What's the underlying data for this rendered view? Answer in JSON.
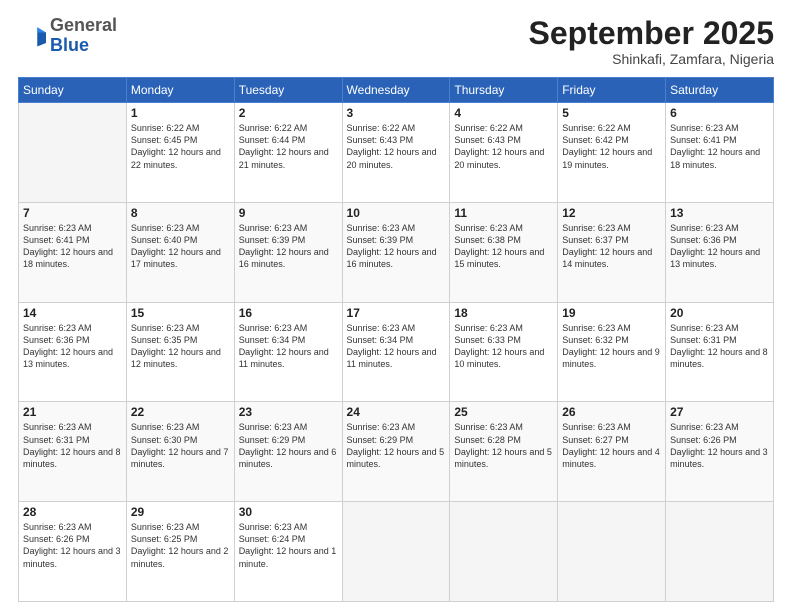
{
  "logo": {
    "general": "General",
    "blue": "Blue"
  },
  "header": {
    "month": "September 2025",
    "location": "Shinkafi, Zamfara, Nigeria"
  },
  "days_of_week": [
    "Sunday",
    "Monday",
    "Tuesday",
    "Wednesday",
    "Thursday",
    "Friday",
    "Saturday"
  ],
  "weeks": [
    [
      {
        "day": "",
        "sunrise": "",
        "sunset": "",
        "daylight": ""
      },
      {
        "day": "1",
        "sunrise": "6:22 AM",
        "sunset": "6:45 PM",
        "daylight": "12 hours and 22 minutes."
      },
      {
        "day": "2",
        "sunrise": "6:22 AM",
        "sunset": "6:44 PM",
        "daylight": "12 hours and 21 minutes."
      },
      {
        "day": "3",
        "sunrise": "6:22 AM",
        "sunset": "6:43 PM",
        "daylight": "12 hours and 20 minutes."
      },
      {
        "day": "4",
        "sunrise": "6:22 AM",
        "sunset": "6:43 PM",
        "daylight": "12 hours and 20 minutes."
      },
      {
        "day": "5",
        "sunrise": "6:22 AM",
        "sunset": "6:42 PM",
        "daylight": "12 hours and 19 minutes."
      },
      {
        "day": "6",
        "sunrise": "6:23 AM",
        "sunset": "6:41 PM",
        "daylight": "12 hours and 18 minutes."
      }
    ],
    [
      {
        "day": "7",
        "sunrise": "6:23 AM",
        "sunset": "6:41 PM",
        "daylight": "12 hours and 18 minutes."
      },
      {
        "day": "8",
        "sunrise": "6:23 AM",
        "sunset": "6:40 PM",
        "daylight": "12 hours and 17 minutes."
      },
      {
        "day": "9",
        "sunrise": "6:23 AM",
        "sunset": "6:39 PM",
        "daylight": "12 hours and 16 minutes."
      },
      {
        "day": "10",
        "sunrise": "6:23 AM",
        "sunset": "6:39 PM",
        "daylight": "12 hours and 16 minutes."
      },
      {
        "day": "11",
        "sunrise": "6:23 AM",
        "sunset": "6:38 PM",
        "daylight": "12 hours and 15 minutes."
      },
      {
        "day": "12",
        "sunrise": "6:23 AM",
        "sunset": "6:37 PM",
        "daylight": "12 hours and 14 minutes."
      },
      {
        "day": "13",
        "sunrise": "6:23 AM",
        "sunset": "6:36 PM",
        "daylight": "12 hours and 13 minutes."
      }
    ],
    [
      {
        "day": "14",
        "sunrise": "6:23 AM",
        "sunset": "6:36 PM",
        "daylight": "12 hours and 13 minutes."
      },
      {
        "day": "15",
        "sunrise": "6:23 AM",
        "sunset": "6:35 PM",
        "daylight": "12 hours and 12 minutes."
      },
      {
        "day": "16",
        "sunrise": "6:23 AM",
        "sunset": "6:34 PM",
        "daylight": "12 hours and 11 minutes."
      },
      {
        "day": "17",
        "sunrise": "6:23 AM",
        "sunset": "6:34 PM",
        "daylight": "12 hours and 11 minutes."
      },
      {
        "day": "18",
        "sunrise": "6:23 AM",
        "sunset": "6:33 PM",
        "daylight": "12 hours and 10 minutes."
      },
      {
        "day": "19",
        "sunrise": "6:23 AM",
        "sunset": "6:32 PM",
        "daylight": "12 hours and 9 minutes."
      },
      {
        "day": "20",
        "sunrise": "6:23 AM",
        "sunset": "6:31 PM",
        "daylight": "12 hours and 8 minutes."
      }
    ],
    [
      {
        "day": "21",
        "sunrise": "6:23 AM",
        "sunset": "6:31 PM",
        "daylight": "12 hours and 8 minutes."
      },
      {
        "day": "22",
        "sunrise": "6:23 AM",
        "sunset": "6:30 PM",
        "daylight": "12 hours and 7 minutes."
      },
      {
        "day": "23",
        "sunrise": "6:23 AM",
        "sunset": "6:29 PM",
        "daylight": "12 hours and 6 minutes."
      },
      {
        "day": "24",
        "sunrise": "6:23 AM",
        "sunset": "6:29 PM",
        "daylight": "12 hours and 5 minutes."
      },
      {
        "day": "25",
        "sunrise": "6:23 AM",
        "sunset": "6:28 PM",
        "daylight": "12 hours and 5 minutes."
      },
      {
        "day": "26",
        "sunrise": "6:23 AM",
        "sunset": "6:27 PM",
        "daylight": "12 hours and 4 minutes."
      },
      {
        "day": "27",
        "sunrise": "6:23 AM",
        "sunset": "6:26 PM",
        "daylight": "12 hours and 3 minutes."
      }
    ],
    [
      {
        "day": "28",
        "sunrise": "6:23 AM",
        "sunset": "6:26 PM",
        "daylight": "12 hours and 3 minutes."
      },
      {
        "day": "29",
        "sunrise": "6:23 AM",
        "sunset": "6:25 PM",
        "daylight": "12 hours and 2 minutes."
      },
      {
        "day": "30",
        "sunrise": "6:23 AM",
        "sunset": "6:24 PM",
        "daylight": "12 hours and 1 minute."
      },
      {
        "day": "",
        "sunrise": "",
        "sunset": "",
        "daylight": ""
      },
      {
        "day": "",
        "sunrise": "",
        "sunset": "",
        "daylight": ""
      },
      {
        "day": "",
        "sunrise": "",
        "sunset": "",
        "daylight": ""
      },
      {
        "day": "",
        "sunrise": "",
        "sunset": "",
        "daylight": ""
      }
    ]
  ]
}
